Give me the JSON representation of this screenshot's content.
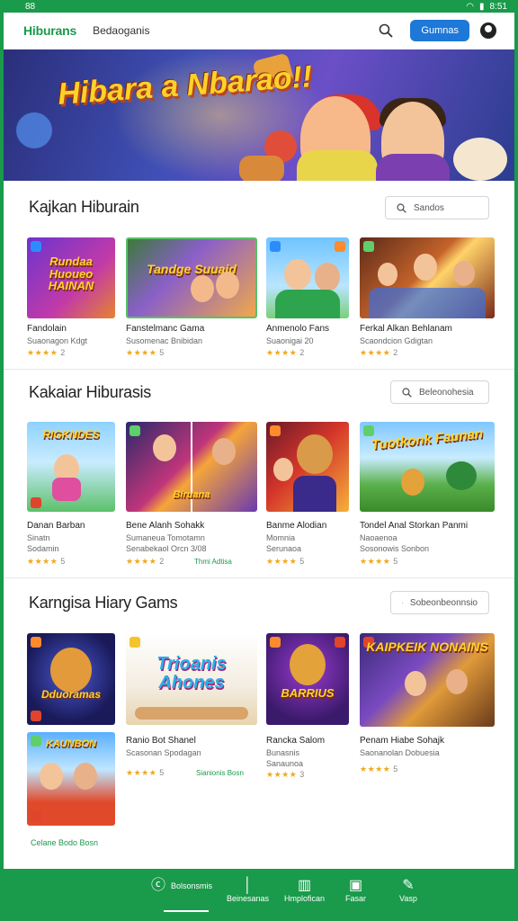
{
  "status": {
    "left": "88",
    "right": "8:51"
  },
  "header": {
    "logo": "Hiburans",
    "nav": "Bedaoganis",
    "button": "Gumnas"
  },
  "hero": {
    "title": "Hibara a Nbarao!!"
  },
  "sections": [
    {
      "title": "Kajkan Hiburain",
      "action": "Sandos",
      "cards": [
        {
          "art": "Rundaa Huoueo HAINAN",
          "title": "Fandolain",
          "sub": "Suaonagon Kdgt",
          "stars": "★★★★",
          "rating": "2"
        },
        {
          "art": "Tandge Suuaid",
          "title": "Fanstelmanc Gama",
          "sub": "Susomenac Bnibidan",
          "stars": "★★★★",
          "rating": "5"
        },
        {
          "art": "",
          "title": "Anmenolo Fans",
          "sub": "Suaonigai 20",
          "stars": "★★★★",
          "rating": "2"
        },
        {
          "art": "",
          "title": "Ferkal Alkan Behlanam",
          "sub": "Scaondcion Gdigtan",
          "stars": "★★★★",
          "rating": "2"
        }
      ]
    },
    {
      "title": "Kakaiar Hiburasis",
      "action": "Beleonohesia",
      "cards": [
        {
          "art": "RIGKNDES",
          "title": "Danan Barban",
          "sub": "Sinatn",
          "sub2": "Sodamin",
          "stars": "★★★★",
          "rating": "5",
          "tag": ""
        },
        {
          "art": "Biruana",
          "title": "Bene Alanh Sohakk",
          "sub": "Sumaneua Tomotamn",
          "sub2": "Senabekaol Orcn 3/08",
          "stars": "★★★★",
          "rating": "2",
          "tag": "Thmi Adtisa"
        },
        {
          "art": "",
          "title": "Banme Alodian",
          "sub": "Momnia",
          "sub2": "Serunaoa",
          "stars": "★★★★",
          "rating": "5",
          "tag": ""
        },
        {
          "art": "Tuotkonk Faunan",
          "title": "Tondel Anal Storkan Panmi",
          "sub": "Naoaenoa",
          "sub2": "Sosonowis Sonbon",
          "stars": "★★★★",
          "rating": "5",
          "tag": ""
        }
      ]
    },
    {
      "title": "Karngisa Hiary Gams",
      "action": "Sobeonbeonnsio",
      "cards": [
        {
          "art": "Dduoramas",
          "title": "",
          "sub": "",
          "stars": "",
          "rating": ""
        },
        {
          "art": "Trioanis Ahones",
          "title": "Ranio Bot Shanel",
          "sub": "Scasonan Spodagan",
          "stars": "★★★★",
          "rating": "5",
          "tag": "Sianionis Bosn"
        },
        {
          "art": "BARRIUS",
          "title": "Rancka Salom",
          "sub": "Bunasnis",
          "sub2": "Sanaunoa",
          "stars": "★★★★",
          "rating": "3"
        },
        {
          "art": "KAIPKEIK NONAINS",
          "title": "Penam Hiabe Sohajk",
          "sub": "Saonanolan Dobuesia",
          "stars": "★★★★",
          "rating": "5"
        },
        {
          "art": "KAUNBON",
          "title": "",
          "sub": "",
          "stars": "",
          "rating": ""
        }
      ],
      "footer_tag": "Celane Bodo Bosn"
    }
  ],
  "bottom_nav": [
    {
      "label": "Bolsonsmis",
      "icon": "home-icon"
    },
    {
      "label": "Beinesanas",
      "icon": "bars-icon"
    },
    {
      "label": "Hmplofican",
      "icon": "document-icon"
    },
    {
      "label": "Fasar",
      "icon": "edit-icon"
    },
    {
      "label": "Vasp",
      "icon": "pencil-icon"
    }
  ],
  "colors": {
    "brand": "#1a9a4b",
    "button": "#1e78d8",
    "star": "#f0a820"
  }
}
